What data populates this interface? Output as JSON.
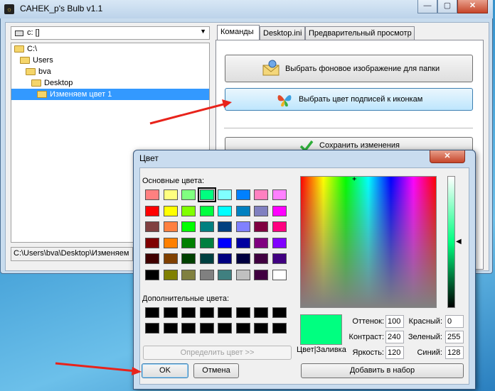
{
  "app": {
    "title": "CAHEK_p's Bulb v1.1",
    "icon_glyph": "☼",
    "caption_buttons": [
      "—",
      "▢",
      "✕"
    ],
    "drive": "c: []",
    "tree": [
      {
        "label": "C:\\",
        "depth": 0,
        "selected": false
      },
      {
        "label": "Users",
        "depth": 1,
        "selected": false
      },
      {
        "label": "bva",
        "depth": 2,
        "selected": false
      },
      {
        "label": "Desktop",
        "depth": 3,
        "selected": false
      },
      {
        "label": "Изменяем цвет 1",
        "depth": 4,
        "selected": true
      }
    ],
    "path": "C:\\Users\\bva\\Desktop\\Изменяем",
    "tabs": [
      "Команды",
      "Desktop.ini",
      "Предварительный просмотр"
    ],
    "active_tab": 0,
    "buttons": {
      "bg_image": "Выбрать фоновое изображение для папки",
      "label_color": "Выбрать цвет подписей к иконкам",
      "save": "Сохранить изменения"
    }
  },
  "dialog": {
    "title": "Цвет",
    "close_glyph": "✕",
    "basic_colors_label": "Основные цвета:",
    "custom_colors_label": "Дополнительные цвета:",
    "basic_colors": [
      [
        "#ff8080",
        "#ffff80",
        "#80ff80",
        "#00ff80",
        "#80ffff",
        "#0080ff",
        "#ff80c0",
        "#ff80ff"
      ],
      [
        "#ff0000",
        "#ffff00",
        "#80ff00",
        "#00ff40",
        "#00ffff",
        "#0080c0",
        "#8080c0",
        "#ff00ff"
      ],
      [
        "#804040",
        "#ff8040",
        "#00ff00",
        "#008080",
        "#004080",
        "#8080ff",
        "#800040",
        "#ff0080"
      ],
      [
        "#800000",
        "#ff8000",
        "#008000",
        "#008040",
        "#0000ff",
        "#0000a0",
        "#800080",
        "#8000ff"
      ],
      [
        "#400000",
        "#804000",
        "#004000",
        "#004040",
        "#000080",
        "#000040",
        "#400040",
        "#400080"
      ],
      [
        "#000000",
        "#808000",
        "#808040",
        "#808080",
        "#408080",
        "#c0c0c0",
        "#400040",
        "#ffffff"
      ]
    ],
    "selected_basic": [
      0,
      3
    ],
    "custom_colors": [
      [
        "#000000",
        "#000000",
        "#000000",
        "#000000",
        "#000000",
        "#000000",
        "#000000",
        "#000000"
      ],
      [
        "#000000",
        "#000000",
        "#000000",
        "#000000",
        "#000000",
        "#000000",
        "#000000",
        "#000000"
      ]
    ],
    "define_button": "Определить цвет >>",
    "ok_button": "OK",
    "cancel_button": "Отмена",
    "preview_label": "Цвет|Заливка",
    "preview_color": "#00ff80",
    "fields": {
      "hue_label": "Оттенок:",
      "hue": "100",
      "sat_label": "Контраст:",
      "sat": "240",
      "lum_label": "Яркость:",
      "lum": "120",
      "red_label": "Красный:",
      "red": "0",
      "green_label": "Зеленый:",
      "green": "255",
      "blue_label": "Синий:",
      "blue": "128"
    },
    "add_button": "Добавить в набор"
  },
  "annotation_color": "#e8231b"
}
